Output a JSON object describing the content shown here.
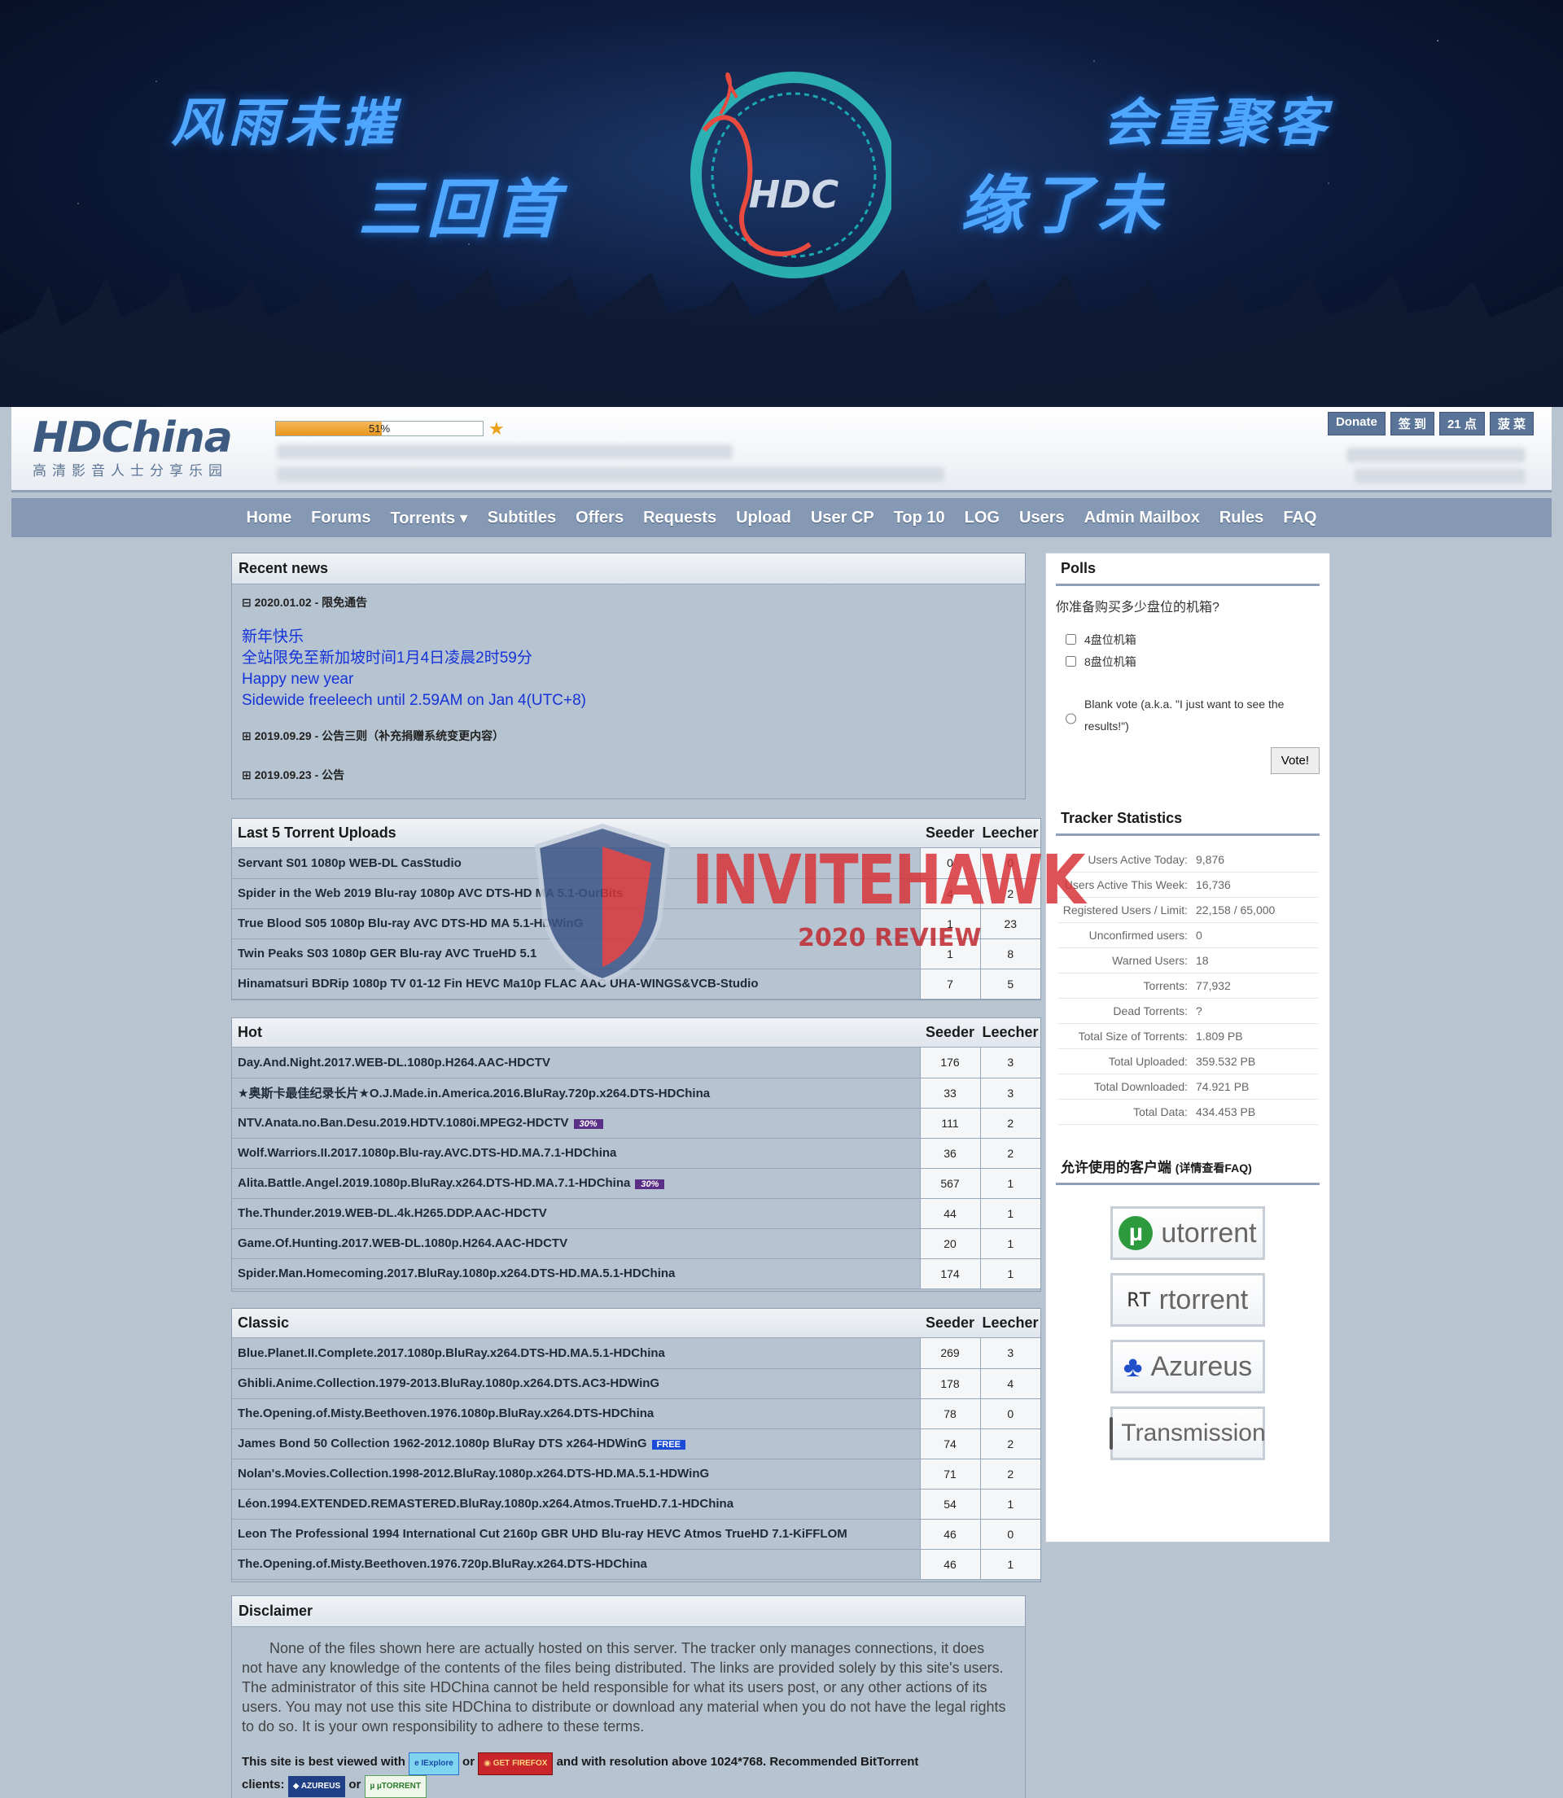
{
  "banner": {
    "slogans": [
      "风雨未摧",
      "三回首",
      "会重聚客",
      "缘了未"
    ],
    "logo_text": "HDC"
  },
  "header": {
    "logo_main": "HDChina",
    "logo_sub": "高清影音人士分享乐园",
    "progress_text": "51%",
    "progress_fraction": 0.51,
    "buttons": [
      "Donate",
      "签 到",
      "21 点",
      "菠 菜"
    ]
  },
  "nav": [
    "Home",
    "Forums",
    "Torrents ▾",
    "Subtitles",
    "Offers",
    "Requests",
    "Upload",
    "User CP",
    "Top 10",
    "LOG",
    "Users",
    "Admin Mailbox",
    "Rules",
    "FAQ"
  ],
  "news": {
    "title": "Recent news",
    "items": [
      {
        "head": "⊟ 2020.01.02 - 限免通告",
        "body": [
          "新年快乐",
          "全站限免至新加坡时间1月4日凌晨2时59分",
          "Happy new year",
          "Sidewide freeleech until 2.59AM on Jan 4(UTC+8)"
        ]
      },
      {
        "head": "⊞ 2019.09.29 - 公告三则（补充捐赠系统变更内容）"
      },
      {
        "head": "⊞ 2019.09.23 - 公告"
      }
    ]
  },
  "col_seeder": "Seeder",
  "col_leecher": "Leecher",
  "last5": {
    "title": "Last 5 Torrent Uploads",
    "rows": [
      {
        "name": "Servant S01 1080p WEB-DL CasStudio",
        "s": "0",
        "l": "0"
      },
      {
        "name": "Spider in the Web 2019 Blu-ray 1080p AVC DTS-HD MA 5.1-OurBits",
        "s": "4",
        "l": "2"
      },
      {
        "name": "True Blood S05 1080p Blu-ray AVC DTS-HD MA 5.1-HDWinG",
        "s": "1",
        "l": "23"
      },
      {
        "name": "Twin Peaks S03 1080p GER Blu-ray AVC TrueHD 5.1",
        "s": "1",
        "l": "8"
      },
      {
        "name": "Hinamatsuri BDRip 1080p TV 01-12 Fin HEVC Ma10p FLAC AAC UHA-WINGS&VCB-Studio",
        "s": "7",
        "l": "5"
      }
    ]
  },
  "hot": {
    "title": "Hot",
    "rows": [
      {
        "name": "Day.And.Night.2017.WEB-DL.1080p.H264.AAC-HDCTV",
        "s": "176",
        "l": "3"
      },
      {
        "name": "★奥斯卡最佳纪录长片★O.J.Made.in.America.2016.BluRay.720p.x264.DTS-HDChina",
        "s": "33",
        "l": "3"
      },
      {
        "name": "NTV.Anata.no.Ban.Desu.2019.HDTV.1080i.MPEG2-HDCTV",
        "s": "111",
        "l": "2",
        "tag": "30%"
      },
      {
        "name": "Wolf.Warriors.II.2017.1080p.Blu-ray.AVC.DTS-HD.MA.7.1-HDChina",
        "s": "36",
        "l": "2"
      },
      {
        "name": "Alita.Battle.Angel.2019.1080p.BluRay.x264.DTS-HD.MA.7.1-HDChina",
        "s": "567",
        "l": "1",
        "tag": "30%"
      },
      {
        "name": "The.Thunder.2019.WEB-DL.4k.H265.DDP.AAC-HDCTV",
        "s": "44",
        "l": "1"
      },
      {
        "name": "Game.Of.Hunting.2017.WEB-DL.1080p.H264.AAC-HDCTV",
        "s": "20",
        "l": "1"
      },
      {
        "name": "Spider.Man.Homecoming.2017.BluRay.1080p.x264.DTS-HD.MA.5.1-HDChina",
        "s": "174",
        "l": "1"
      }
    ]
  },
  "classic": {
    "title": "Classic",
    "rows": [
      {
        "name": "Blue.Planet.II.Complete.2017.1080p.BluRay.x264.DTS-HD.MA.5.1-HDChina",
        "s": "269",
        "l": "3"
      },
      {
        "name": "Ghibli.Anime.Collection.1979-2013.BluRay.1080p.x264.DTS.AC3-HDWinG",
        "s": "178",
        "l": "4"
      },
      {
        "name": "The.Opening.of.Misty.Beethoven.1976.1080p.BluRay.x264.DTS-HDChina",
        "s": "78",
        "l": "0"
      },
      {
        "name": "James Bond 50 Collection 1962-2012.1080p BluRay DTS x264-HDWinG",
        "s": "74",
        "l": "2",
        "free": "FREE"
      },
      {
        "name": "Nolan's.Movies.Collection.1998-2012.BluRay.1080p.x264.DTS-HD.MA.5.1-HDWinG",
        "s": "71",
        "l": "2"
      },
      {
        "name": "Léon.1994.EXTENDED.REMASTERED.BluRay.1080p.x264.Atmos.TrueHD.7.1-HDChina",
        "s": "54",
        "l": "1"
      },
      {
        "name": "Leon The Professional 1994 International Cut 2160p GBR UHD Blu-ray HEVC Atmos TrueHD 7.1-KiFFLOM",
        "s": "46",
        "l": "0"
      },
      {
        "name": "The.Opening.of.Misty.Beethoven.1976.720p.BluRay.x264.DTS-HDChina",
        "s": "46",
        "l": "1"
      }
    ]
  },
  "disclaimer": {
    "title": "Disclaimer",
    "text": "None of the files shown here are actually hosted on this server. The tracker only manages connections, it does not have any knowledge of the contents of the files being distributed. The links are provided solely by this site's users. The administrator of this site HDChina cannot be held responsible for what its users post, or any other actions of its users. You may not use this site HDChina to distribute or download any material when you do not have the legal rights to do so. It is your own responsibility to adhere to these terms.",
    "best_pre": "This site is best viewed with",
    "best_or": "or",
    "best_post": "and with resolution above 1024*768. Recommended BitTorrent",
    "clients_pre": "clients:",
    "clients_or": "or",
    "badge_ie": "IExplore",
    "badge_ff": "GET FIREFOX",
    "badge_az": "AZUREUS",
    "badge_ut": "µTORRENT"
  },
  "polls": {
    "title": "Polls",
    "question": "你准备购买多少盘位的机箱?",
    "options": [
      "4盘位机箱",
      "8盘位机箱"
    ],
    "blank": "Blank vote (a.k.a. \"I just want to see the results!\")",
    "vote": "Vote!"
  },
  "stats": {
    "title": "Tracker Statistics",
    "rows": [
      {
        "k": "Users Active Today:",
        "v": "9,876"
      },
      {
        "k": "Users Active This Week:",
        "v": "16,736"
      },
      {
        "k": "Registered Users / Limit:",
        "v": "22,158 / 65,000"
      },
      {
        "k": "Unconfirmed users:",
        "v": "0"
      },
      {
        "k": "Warned Users:",
        "v": "18"
      },
      {
        "k": "Torrents:",
        "v": "77,932"
      },
      {
        "k": "Dead Torrents:",
        "v": "?"
      },
      {
        "k": "Total Size of Torrents:",
        "v": "1.809 PB"
      },
      {
        "k": "Total Uploaded:",
        "v": "359.532 PB"
      },
      {
        "k": "Total Downloaded:",
        "v": "74.921 PB"
      },
      {
        "k": "Total Data:",
        "v": "434.453 PB"
      }
    ]
  },
  "clients": {
    "title": "允许使用的客户端",
    "note": "(详情查看FAQ)",
    "items": [
      "utorrent",
      "rtorrent",
      "Azureus",
      "Transmission"
    ],
    "rt_badge": "RT"
  },
  "watermark": {
    "brand": "INVITEHAWK",
    "year_text": "2020 REVIEW"
  },
  "colors": {
    "nav": "#8599b4",
    "accent": "#5a7497",
    "link_blue": "#1533d8",
    "tag_purple": "#5b2f86"
  }
}
